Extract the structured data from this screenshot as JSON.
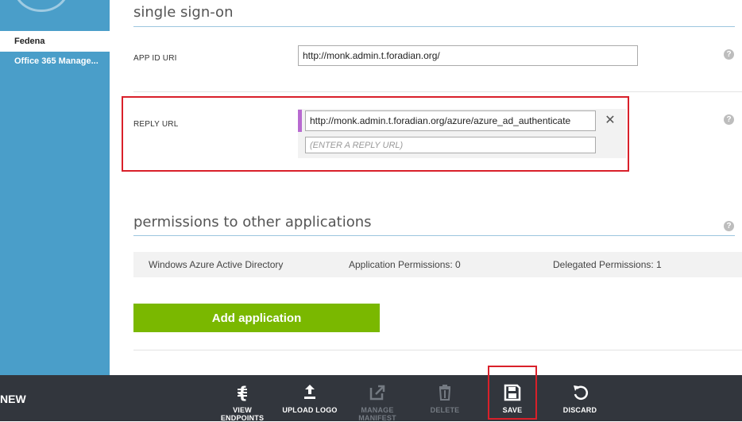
{
  "sidebar": {
    "items": [
      {
        "label": "Fedena"
      },
      {
        "label": "Office 365 Manage..."
      }
    ]
  },
  "sso": {
    "title": "single sign-on",
    "app_id_label": "APP ID URI",
    "app_id_value": "http://monk.admin.t.foradian.org/",
    "reply_label": "REPLY URL",
    "reply_value": "http://monk.admin.t.foradian.org/azure/azure_ad_authenticate",
    "reply_placeholder": "(ENTER A REPLY URL)",
    "remove_glyph": "✕",
    "help_glyph": "?"
  },
  "permissions": {
    "title": "permissions to other applications",
    "row": {
      "app": "Windows Azure Active Directory",
      "app_perms": "Application Permissions: 0",
      "delegated_perms": "Delegated Permissions: 1"
    },
    "add_button": "Add application"
  },
  "commandbar": {
    "new_label": "NEW",
    "commands": [
      {
        "label": "VIEW ENDPOINTS",
        "icon": "endpoints-icon",
        "enabled": true
      },
      {
        "label": "UPLOAD LOGO",
        "icon": "upload-icon",
        "enabled": true
      },
      {
        "label": "MANAGE MANIFEST",
        "icon": "external-link-icon",
        "enabled": false
      },
      {
        "label": "DELETE",
        "icon": "trash-icon",
        "enabled": false
      },
      {
        "label": "SAVE",
        "icon": "save-icon",
        "enabled": true
      },
      {
        "label": "DISCARD",
        "icon": "undo-icon",
        "enabled": true
      }
    ]
  },
  "colors": {
    "sidebar": "#4a9ec9",
    "accent_green": "#7ab800",
    "highlight_red": "#d9202a",
    "commandbar": "#32363d"
  }
}
